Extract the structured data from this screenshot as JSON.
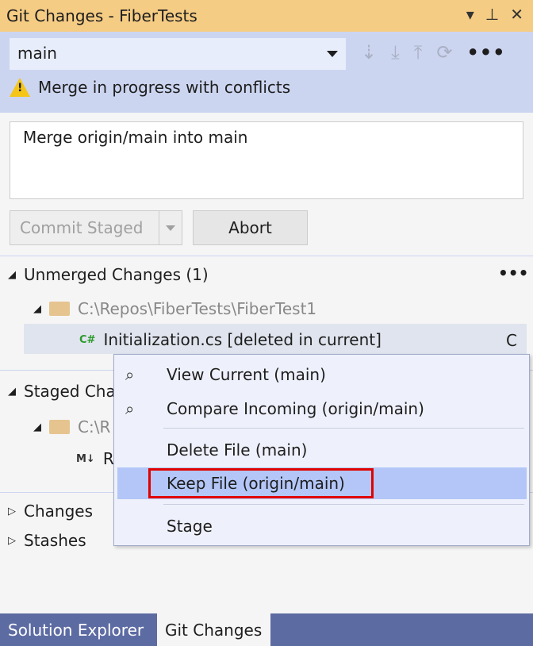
{
  "window": {
    "title": "Git Changes - FiberTests"
  },
  "branch": {
    "value": "main"
  },
  "toolbar": {
    "more": "•••"
  },
  "warning": "Merge in progress with conflicts",
  "commit_message": "Merge origin/main into main",
  "buttons": {
    "commit_staged": "Commit Staged",
    "abort": "Abort"
  },
  "unmerged": {
    "title": "Unmerged Changes (1)",
    "more": "•••",
    "folder": "C:\\Repos\\FiberTests\\FiberTest1",
    "file": {
      "icon": "C#",
      "name": "Initialization.cs [deleted in current]",
      "status": "C"
    }
  },
  "staged": {
    "title": "Staged Cha",
    "folder": "C:\\R",
    "file_icon": "M↓",
    "file": "R"
  },
  "sections": {
    "changes": "Changes",
    "stashes": "Stashes"
  },
  "context_menu": {
    "items": [
      "View Current (main)",
      "Compare Incoming (origin/main)",
      "Delete File (main)",
      "Keep File (origin/main)",
      "Stage"
    ],
    "highlighted": "Keep File (origin/main)"
  },
  "tabs": [
    "Solution Explorer",
    "Git Changes"
  ],
  "active_tab": "Git Changes",
  "colors": {
    "title_bar": "#f5cc84",
    "header": "#ccd5f0",
    "highlight": "#b3c6f7",
    "callout": "#e00000",
    "tab_bar": "#5d6ba3"
  }
}
